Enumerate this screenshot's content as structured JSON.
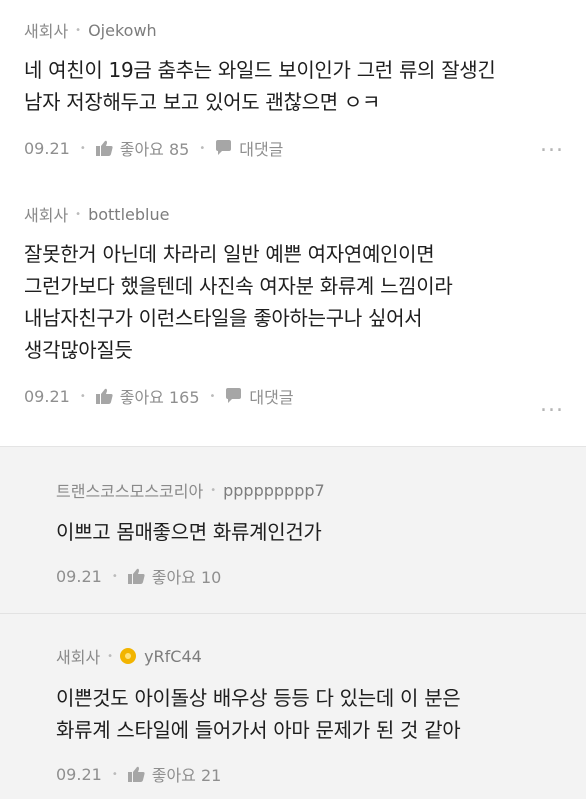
{
  "comments": [
    {
      "nickname": "새회사",
      "username": "Ojekowh",
      "text_lines": [
        "네 여친이 19금 춤추는 와일드 보이인가 그런 류의 잘생긴",
        "남자 저장해두고 보고 있어도 괜찮으면 ㅇㅋ"
      ],
      "date": "09.21",
      "like_label": "좋아요 85",
      "reply_label": "대댓글",
      "more": "..."
    },
    {
      "nickname": "새회사",
      "username": "bottleblue",
      "text_lines": [
        "잘못한거 아닌데 차라리 일반 예쁜 여자연예인이면",
        "그런가보다 했을텐데 사진속 여자분 화류계 느낌이라",
        "내남자친구가 이런스타일을 좋아하는구나 싶어서",
        "생각많아질듯"
      ],
      "date": "09.21",
      "like_label": "좋아요 165",
      "reply_label": "대댓글",
      "more": "..."
    }
  ],
  "replies": [
    {
      "nickname": "트랜스코스모스코리아",
      "username": "ppppppppp7",
      "text_lines": [
        "이쁘고 몸매좋으면 화류계인건가"
      ],
      "date": "09.21",
      "like_label": "좋아요 10"
    },
    {
      "nickname": "새회사",
      "username": "yRfC44",
      "text_lines": [
        "이쁜것도 아이돌상 배우상 등등 다 있는데 이 분은",
        "화류계 스타일에 들어가서 아마 문제가 된 것 같아"
      ],
      "date": "09.21",
      "like_label": "좋아요 21"
    }
  ]
}
